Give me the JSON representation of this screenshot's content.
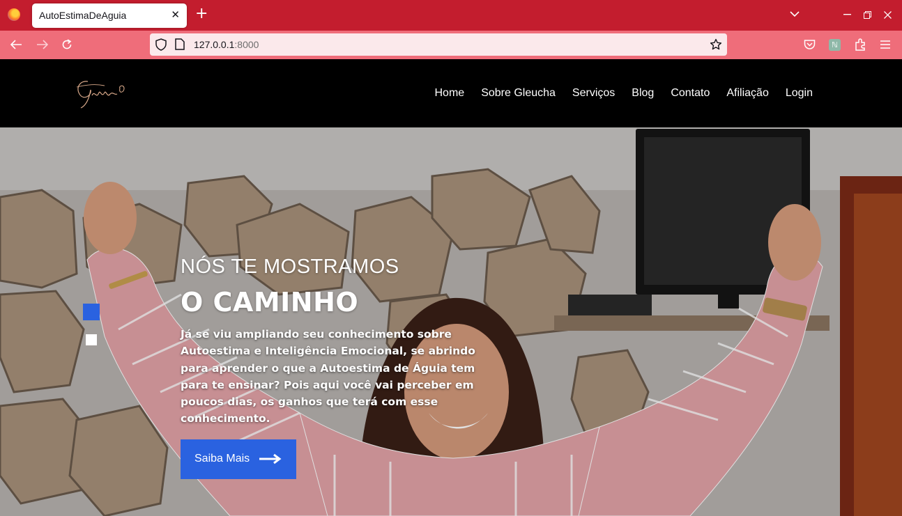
{
  "browser": {
    "tab_title": "AutoEstimaDeAguia",
    "tab_close": "✕",
    "new_tab": "+",
    "url_host": "127.0.0.1",
    "url_port": ":8000",
    "icons": [
      "back-icon",
      "forward-icon",
      "reload-icon",
      "shield-icon",
      "page-icon",
      "star-icon",
      "pocket-icon",
      "extension-icon",
      "puzzle-icon",
      "menu-icon",
      "chevron-down-icon",
      "minimize-icon",
      "restore-icon",
      "close-icon"
    ],
    "colors": {
      "tabbar": "#c31d2e",
      "navbar": "#ef6d7a",
      "urlbar": "#fbe9eb"
    }
  },
  "site": {
    "logo_text": "Gm",
    "nav": [
      "Home",
      "Sobre Gleucha",
      "Serviços",
      "Blog",
      "Contato",
      "Afiliação",
      "Login"
    ]
  },
  "hero": {
    "subtitle": "NÓS TE MOSTRAMOS",
    "title": "O CAMINHO",
    "text": "Já se viu ampliando seu conhecimento sobre Autoestima e Inteligência Emocional, se abrindo para aprender o que a Autoestima de Águia tem para te ensinar? Pois aqui você vai perceber em poucos dias, os ganhos que terá com esse conhecimento.",
    "cta_label": "Saiba Mais",
    "slides": 2,
    "active_slide": 1,
    "colors": {
      "accent": "#2a62e0"
    }
  }
}
